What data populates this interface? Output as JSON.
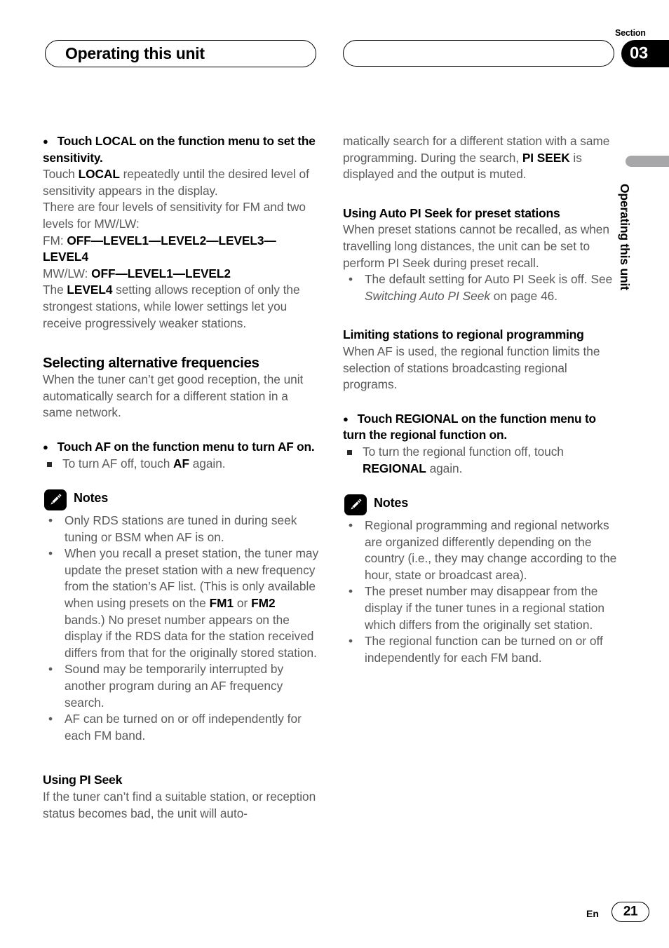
{
  "header": {
    "title": "Operating this unit",
    "section_label": "Section",
    "section_number": "03",
    "empty_pill": ""
  },
  "side_tab": {
    "vertical_text": "Operating this unit",
    "marker_color": "#a7a7a9"
  },
  "left_column": {
    "action_local": {
      "bullet": "●",
      "text": "Touch LOCAL on the function menu to set the sensitivity."
    },
    "paragraph_local_1_a": "Touch ",
    "paragraph_local_1_b": "LOCAL",
    "paragraph_local_1_c": " repeatedly until the desired level of sensitivity appears in the display.",
    "paragraph_local_2": "There are four levels of sensitivity for FM and two levels for MW/LW:",
    "fm_label": "FM: ",
    "fm_values": "OFF—LEVEL1—LEVEL2—LEVEL3—LEVEL4",
    "mwlw_label": "MW/LW: ",
    "mwlw_values": "OFF—LEVEL1—LEVEL2",
    "paragraph_level4_a": "The ",
    "paragraph_level4_b": "LEVEL4",
    "paragraph_level4_c": " setting allows reception of only the strongest stations, while lower settings let you receive progressively weaker stations.",
    "heading_alt_freq": "Selecting alternative frequencies",
    "paragraph_alt_freq": "When the tuner can’t get good reception, the unit automatically search for a different station in a same network.",
    "action_af": {
      "bullet": "●",
      "text": "Touch AF on the function menu to turn AF on."
    },
    "sq_af_a": "To turn AF off, touch ",
    "sq_af_b": "AF",
    "sq_af_c": " again.",
    "notes_label": "Notes",
    "notes_icon": "pencil-icon",
    "notes": [
      {
        "parts": [
          {
            "t": "Only RDS stations are tuned in during seek tuning or BSM when AF is on.",
            "b": false
          }
        ]
      },
      {
        "parts": [
          {
            "t": "When you recall a preset station, the tuner may update the preset station with a new frequency from the station’s AF list. (This is only available when using presets on the ",
            "b": false
          },
          {
            "t": "FM1",
            "b": true
          },
          {
            "t": " or ",
            "b": false
          },
          {
            "t": "FM2",
            "b": true
          },
          {
            "t": " bands.) No preset number appears on the display if the RDS data for the station received differs from that for the originally stored station.",
            "b": false
          }
        ]
      },
      {
        "parts": [
          {
            "t": "Sound may be temporarily interrupted by another program during an AF frequency search.",
            "b": false
          }
        ]
      },
      {
        "parts": [
          {
            "t": "AF can be turned on or off independently for each FM band.",
            "b": false
          }
        ]
      }
    ],
    "heading_pi_seek": "Using PI Seek",
    "paragraph_pi_seek": "If the tuner can’t find a suitable station, or reception status becomes bad, the unit will auto-"
  },
  "right_column": {
    "paragraph_continuation_a": "matically search for a different station with a same programming. During the search, ",
    "paragraph_continuation_b": "PI SEEK",
    "paragraph_continuation_c": " is displayed and the output is muted.",
    "heading_auto_pi": "Using Auto PI Seek for preset stations",
    "paragraph_auto_pi": "When preset stations cannot be recalled, as when travelling long distances, the unit can be set to perform PI Seek during preset recall.",
    "bullet_auto_pi_a": "The default setting for Auto PI Seek is off. See ",
    "bullet_auto_pi_italic": "Switching Auto PI Seek",
    "bullet_auto_pi_b": " on page 46.",
    "heading_regional": "Limiting stations to regional programming",
    "paragraph_regional": "When AF is used, the regional function limits the selection of stations broadcasting regional programs.",
    "action_regional": {
      "bullet": "●",
      "text": "Touch REGIONAL on the function menu to turn the regional function on."
    },
    "sq_regional_a": "To turn the regional function off, touch ",
    "sq_regional_b": "REGIONAL",
    "sq_regional_c": " again.",
    "notes_label": "Notes",
    "notes_icon": "pencil-icon",
    "notes": [
      {
        "parts": [
          {
            "t": "Regional programming and regional networks are organized differently depending on the country (i.e., they may change according to the hour, state or broadcast area).",
            "b": false
          }
        ]
      },
      {
        "parts": [
          {
            "t": "The preset number may disappear from the display if the tuner tunes in a regional station which differs from the originally set station.",
            "b": false
          }
        ]
      },
      {
        "parts": [
          {
            "t": "The regional function can be turned on or off independently for each FM band.",
            "b": false
          }
        ]
      }
    ]
  },
  "footer": {
    "language": "En",
    "page_number": "21"
  },
  "bullets": {
    "dot": "•",
    "circle": "●"
  }
}
